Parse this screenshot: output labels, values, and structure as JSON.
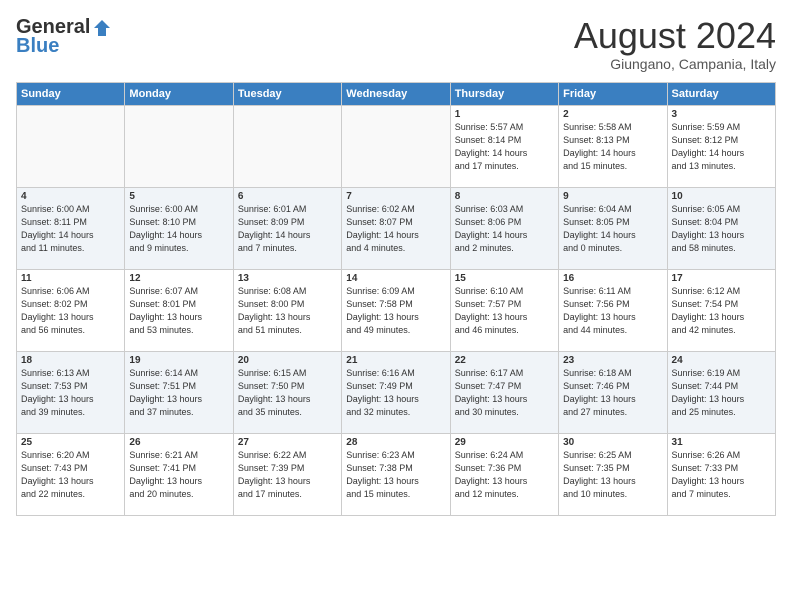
{
  "header": {
    "logo_general": "General",
    "logo_blue": "Blue",
    "title": "August 2024",
    "location": "Giungano, Campania, Italy"
  },
  "weekdays": [
    "Sunday",
    "Monday",
    "Tuesday",
    "Wednesday",
    "Thursday",
    "Friday",
    "Saturday"
  ],
  "weeks": [
    [
      {
        "day": "",
        "info": ""
      },
      {
        "day": "",
        "info": ""
      },
      {
        "day": "",
        "info": ""
      },
      {
        "day": "",
        "info": ""
      },
      {
        "day": "1",
        "info": "Sunrise: 5:57 AM\nSunset: 8:14 PM\nDaylight: 14 hours\nand 17 minutes."
      },
      {
        "day": "2",
        "info": "Sunrise: 5:58 AM\nSunset: 8:13 PM\nDaylight: 14 hours\nand 15 minutes."
      },
      {
        "day": "3",
        "info": "Sunrise: 5:59 AM\nSunset: 8:12 PM\nDaylight: 14 hours\nand 13 minutes."
      }
    ],
    [
      {
        "day": "4",
        "info": "Sunrise: 6:00 AM\nSunset: 8:11 PM\nDaylight: 14 hours\nand 11 minutes."
      },
      {
        "day": "5",
        "info": "Sunrise: 6:00 AM\nSunset: 8:10 PM\nDaylight: 14 hours\nand 9 minutes."
      },
      {
        "day": "6",
        "info": "Sunrise: 6:01 AM\nSunset: 8:09 PM\nDaylight: 14 hours\nand 7 minutes."
      },
      {
        "day": "7",
        "info": "Sunrise: 6:02 AM\nSunset: 8:07 PM\nDaylight: 14 hours\nand 4 minutes."
      },
      {
        "day": "8",
        "info": "Sunrise: 6:03 AM\nSunset: 8:06 PM\nDaylight: 14 hours\nand 2 minutes."
      },
      {
        "day": "9",
        "info": "Sunrise: 6:04 AM\nSunset: 8:05 PM\nDaylight: 14 hours\nand 0 minutes."
      },
      {
        "day": "10",
        "info": "Sunrise: 6:05 AM\nSunset: 8:04 PM\nDaylight: 13 hours\nand 58 minutes."
      }
    ],
    [
      {
        "day": "11",
        "info": "Sunrise: 6:06 AM\nSunset: 8:02 PM\nDaylight: 13 hours\nand 56 minutes."
      },
      {
        "day": "12",
        "info": "Sunrise: 6:07 AM\nSunset: 8:01 PM\nDaylight: 13 hours\nand 53 minutes."
      },
      {
        "day": "13",
        "info": "Sunrise: 6:08 AM\nSunset: 8:00 PM\nDaylight: 13 hours\nand 51 minutes."
      },
      {
        "day": "14",
        "info": "Sunrise: 6:09 AM\nSunset: 7:58 PM\nDaylight: 13 hours\nand 49 minutes."
      },
      {
        "day": "15",
        "info": "Sunrise: 6:10 AM\nSunset: 7:57 PM\nDaylight: 13 hours\nand 46 minutes."
      },
      {
        "day": "16",
        "info": "Sunrise: 6:11 AM\nSunset: 7:56 PM\nDaylight: 13 hours\nand 44 minutes."
      },
      {
        "day": "17",
        "info": "Sunrise: 6:12 AM\nSunset: 7:54 PM\nDaylight: 13 hours\nand 42 minutes."
      }
    ],
    [
      {
        "day": "18",
        "info": "Sunrise: 6:13 AM\nSunset: 7:53 PM\nDaylight: 13 hours\nand 39 minutes."
      },
      {
        "day": "19",
        "info": "Sunrise: 6:14 AM\nSunset: 7:51 PM\nDaylight: 13 hours\nand 37 minutes."
      },
      {
        "day": "20",
        "info": "Sunrise: 6:15 AM\nSunset: 7:50 PM\nDaylight: 13 hours\nand 35 minutes."
      },
      {
        "day": "21",
        "info": "Sunrise: 6:16 AM\nSunset: 7:49 PM\nDaylight: 13 hours\nand 32 minutes."
      },
      {
        "day": "22",
        "info": "Sunrise: 6:17 AM\nSunset: 7:47 PM\nDaylight: 13 hours\nand 30 minutes."
      },
      {
        "day": "23",
        "info": "Sunrise: 6:18 AM\nSunset: 7:46 PM\nDaylight: 13 hours\nand 27 minutes."
      },
      {
        "day": "24",
        "info": "Sunrise: 6:19 AM\nSunset: 7:44 PM\nDaylight: 13 hours\nand 25 minutes."
      }
    ],
    [
      {
        "day": "25",
        "info": "Sunrise: 6:20 AM\nSunset: 7:43 PM\nDaylight: 13 hours\nand 22 minutes."
      },
      {
        "day": "26",
        "info": "Sunrise: 6:21 AM\nSunset: 7:41 PM\nDaylight: 13 hours\nand 20 minutes."
      },
      {
        "day": "27",
        "info": "Sunrise: 6:22 AM\nSunset: 7:39 PM\nDaylight: 13 hours\nand 17 minutes."
      },
      {
        "day": "28",
        "info": "Sunrise: 6:23 AM\nSunset: 7:38 PM\nDaylight: 13 hours\nand 15 minutes."
      },
      {
        "day": "29",
        "info": "Sunrise: 6:24 AM\nSunset: 7:36 PM\nDaylight: 13 hours\nand 12 minutes."
      },
      {
        "day": "30",
        "info": "Sunrise: 6:25 AM\nSunset: 7:35 PM\nDaylight: 13 hours\nand 10 minutes."
      },
      {
        "day": "31",
        "info": "Sunrise: 6:26 AM\nSunset: 7:33 PM\nDaylight: 13 hours\nand 7 minutes."
      }
    ]
  ]
}
